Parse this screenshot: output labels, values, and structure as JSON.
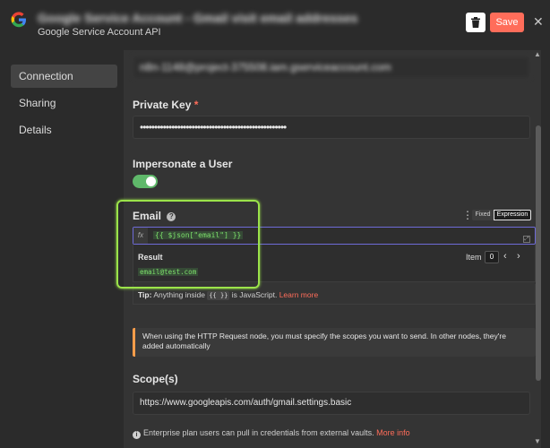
{
  "header": {
    "title": "Google Service Account - Gmail visit email addresses",
    "subtitle": "Google Service Account API",
    "save_label": "Save",
    "delete_icon": "trash-icon",
    "close_icon": "close-icon"
  },
  "sidebar": {
    "items": [
      {
        "label": "Connection",
        "active": true
      },
      {
        "label": "Sharing",
        "active": false
      },
      {
        "label": "Details",
        "active": false
      }
    ]
  },
  "form": {
    "service_email_value": "n8n-1148@project-375508.iam.gserviceaccount.com",
    "private_key_label": "Private Key",
    "private_key_required": "*",
    "private_key_value": "•••••••••••••••••••••••••••••••••••••••••••••••••••",
    "impersonate_label": "Impersonate a User",
    "impersonate_on": true,
    "email_label": "Email",
    "email_mode_fixed": "Fixed",
    "email_mode_expression": "Expression",
    "email_expression_prefix": "fx",
    "email_expression": "{{ $json[\"email\"] }}",
    "result_label": "Result",
    "result_value": "email@test.com",
    "item_label": "Item",
    "item_index": "0",
    "tip_prefix": "Tip:",
    "tip_text": " Anything inside ",
    "tip_code": "{{ }}",
    "tip_suffix": " is JavaScript. ",
    "tip_link": "Learn more",
    "notice_text": "When using the HTTP Request node, you must specify the scopes you want to send. In other nodes, they're added automatically",
    "scopes_label": "Scope(s)",
    "scopes_value": "https://www.googleapis.com/auth/gmail.settings.basic",
    "enterprise_text": "Enterprise plan users can pull in credentials from external vaults.",
    "enterprise_link": "More info"
  },
  "colors": {
    "accent": "#ff6d5a",
    "toggle_on": "#5fb86a",
    "highlight_frame": "#9be34a",
    "expression_border": "#6e6bd8"
  }
}
